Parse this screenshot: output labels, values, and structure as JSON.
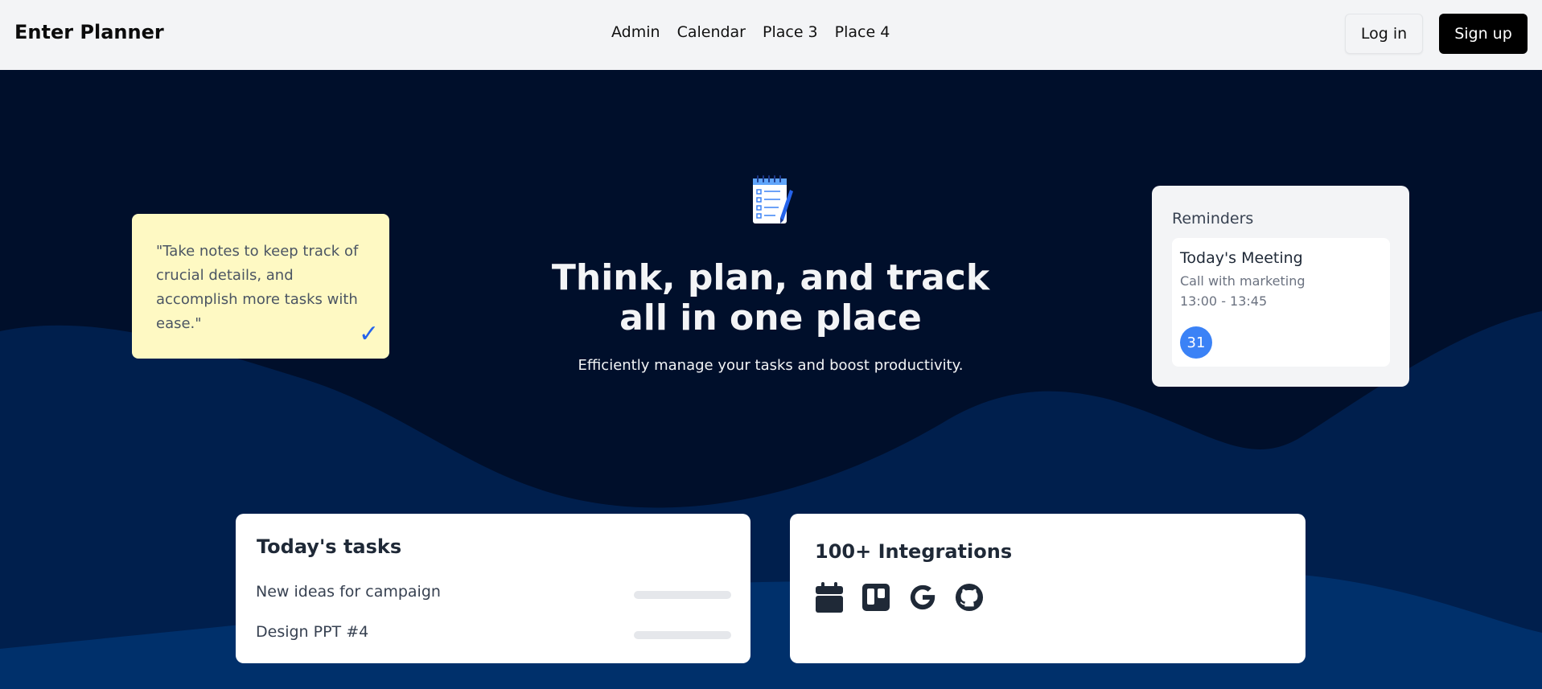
{
  "header": {
    "brand": "Enter Planner",
    "nav": [
      "Admin",
      "Calendar",
      "Place 3",
      "Place 4"
    ],
    "login_label": "Log in",
    "signup_label": "Sign up"
  },
  "hero": {
    "icon": "notepad-icon",
    "headline_line1": "Think, plan, and track",
    "headline_line2": "all in one place",
    "subline": "Efficiently manage your tasks and boost productivity."
  },
  "sticky_note": {
    "text": "\"Take notes to keep track of crucial details, and accomplish more tasks with ease.\"",
    "icon": "checkmark-icon",
    "color": "#fef9c3"
  },
  "reminders": {
    "title": "Reminders",
    "meeting_title": "Today's Meeting",
    "meeting_desc": "Call with marketing",
    "meeting_time": "13:00 - 13:45",
    "badge": "31"
  },
  "tasks": {
    "title": "Today's tasks",
    "items": [
      "New ideas for campaign",
      "Design PPT #4"
    ]
  },
  "integrations": {
    "title": "100+ Integrations",
    "icons": [
      "calendar-icon",
      "trello-icon",
      "google-icon",
      "github-icon"
    ]
  },
  "colors": {
    "hero_dark": "#000f2b",
    "wave_mid": "#001f4d",
    "wave_front": "#00306b",
    "accent_blue": "#3b82f6",
    "signup_bg": "#000000"
  }
}
